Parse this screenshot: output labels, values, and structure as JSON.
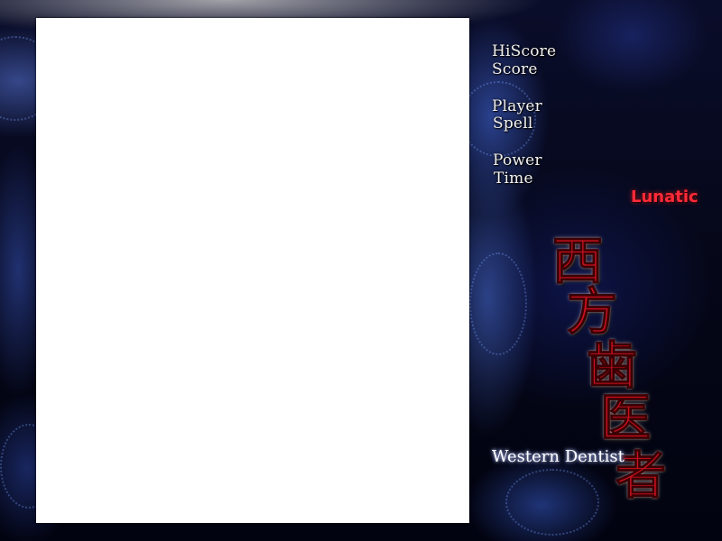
{
  "hud": {
    "hiscore_label": "HiScore",
    "score_label": "Score",
    "player_label": "Player",
    "spell_label": "Spell",
    "power_label": "Power",
    "time_label": "Time"
  },
  "difficulty": "Lunatic",
  "title": {
    "kanji": [
      "西",
      "方",
      "歯",
      "医",
      "者"
    ],
    "subtitle": "Western Dentist"
  },
  "colors": {
    "difficulty": "#ff2a3a",
    "title_kanji": "#c8121e",
    "playfield": "#ffffff"
  }
}
